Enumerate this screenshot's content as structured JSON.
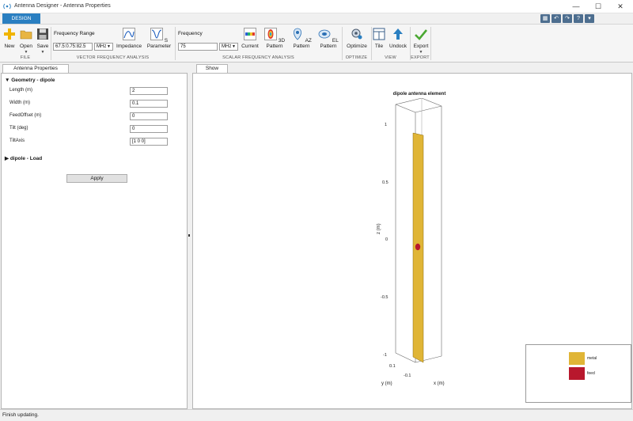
{
  "window": {
    "title": "Antenna Designer - Antenna Properties",
    "controls": {
      "minimize": "—",
      "maximize": "☐",
      "close": "✕"
    }
  },
  "ribbon": {
    "tab": "DESIGN",
    "file": {
      "section": "FILE",
      "new_label": "New",
      "open_label": "Open",
      "save_label": "Save"
    },
    "vector": {
      "section": "VECTOR FREQUENCY ANALYSIS",
      "frequency_range_label": "Frequency Range",
      "frequency_range_value": "67.5:0.75:82.5",
      "unit": "MHz",
      "impedance_label": "Impedance",
      "sparameter_label": "S Parameter"
    },
    "scalar": {
      "section": "SCALAR FREQUENCY ANALYSIS",
      "frequency_label": "Frequency",
      "frequency_value": "75",
      "unit": "MHz",
      "current_label": "Current",
      "pattern3d_label": "3D Pattern",
      "azpattern_label": "AZ Pattern",
      "elpattern_label": "EL Pattern"
    },
    "optimize": {
      "section": "OPTIMIZE",
      "optimize_label": "Optimize"
    },
    "view": {
      "section": "VIEW",
      "tile_label": "Tile",
      "undock_label": "Undock"
    },
    "export": {
      "section": "EXPORT",
      "export_label": "Export"
    }
  },
  "properties_panel": {
    "tab": "Antenna Properties",
    "geometry_group": "Geometry - dipole",
    "fields": [
      {
        "label": "Length (m)",
        "value": "2"
      },
      {
        "label": "Width (m)",
        "value": "0.1"
      },
      {
        "label": "FeedOffset (m)",
        "value": "0"
      },
      {
        "label": "Tilt (deg)",
        "value": "0"
      },
      {
        "label": "TiltAxis",
        "value": "[1 0 0]"
      }
    ],
    "load_group": "dipole - Load",
    "apply_label": "Apply"
  },
  "plot_panel": {
    "tab": "Show",
    "title": "dipole antenna element",
    "z_axis_label": "z (m)",
    "y_axis_label": "y (m)",
    "x_axis_label": "x (m)",
    "z_ticks": [
      "1",
      "0.5",
      "0",
      "-0.5",
      "-1"
    ],
    "y_tick": "0.1",
    "x_tick": "-0.1",
    "legend": [
      {
        "label": "metal",
        "color": "#e0b536"
      },
      {
        "label": "feed",
        "color": "#b8182d"
      }
    ]
  },
  "status": {
    "text": "Finish updating."
  },
  "colors": {
    "accent": "#2a7fc1",
    "metal": "#e0b536",
    "feed": "#b8182d"
  }
}
